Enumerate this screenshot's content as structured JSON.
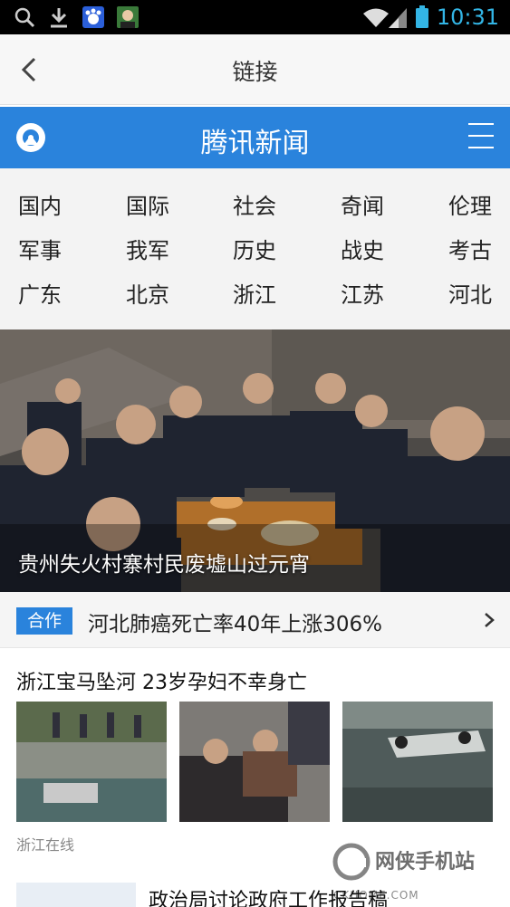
{
  "status_bar": {
    "time": "10:31",
    "icons": [
      "search-icon",
      "download-icon",
      "baidu-app-icon",
      "avatar-app-icon",
      "wifi-icon",
      "signal-icon",
      "battery-icon"
    ]
  },
  "appbar": {
    "title": "链接"
  },
  "brand": {
    "title": "腾讯新闻",
    "accent": "#2a83dc"
  },
  "categories": [
    [
      "国内",
      "国际",
      "社会",
      "奇闻",
      "伦理"
    ],
    [
      "军事",
      "我军",
      "历史",
      "战史",
      "考古"
    ],
    [
      "广东",
      "北京",
      "浙江",
      "江苏",
      "河北"
    ]
  ],
  "hero": {
    "caption": "贵州失火村寨村民废墟山过元宵"
  },
  "promo": {
    "badge": "合作",
    "text": "河北肺癌死亡率40年上涨306%"
  },
  "article": {
    "title": "浙江宝马坠河 23岁孕妇不幸身亡",
    "source": "浙江在线"
  },
  "next_article": {
    "title": "政治局讨论政府工作报告稿"
  },
  "watermark": {
    "text": "网侠手机站",
    "url": "CKHOME.COM"
  }
}
